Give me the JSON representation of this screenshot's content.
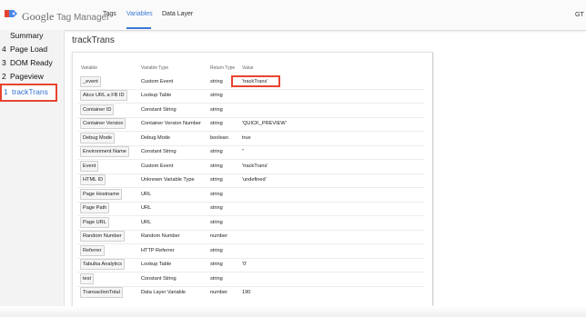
{
  "header": {
    "brand_google": "Google",
    "brand_product": "Tag Manager",
    "nav": [
      "Tags",
      "Variables",
      "Data Layer"
    ],
    "active_nav": "Variables",
    "right_label": "GT",
    "accent_color": "#3a78d4"
  },
  "sidebar": {
    "items": [
      {
        "num": "",
        "label": "Summary"
      },
      {
        "num": "4",
        "label": "Page Load"
      },
      {
        "num": "3",
        "label": "DOM Ready"
      },
      {
        "num": "2",
        "label": "Pageview"
      },
      {
        "num": "1",
        "label": "trackTrans"
      }
    ],
    "selected": "trackTrans",
    "highlight_color": "#e8432f"
  },
  "main": {
    "title": "trackTrans",
    "columns": [
      "Variable",
      "Variable Type",
      "Return Type",
      "Value"
    ],
    "rows": [
      {
        "variable": "_event",
        "type": "Custom Event",
        "return": "string",
        "value": "'trackTrans'"
      },
      {
        "variable": "Akce URL a FB ID",
        "type": "Lookup Table",
        "return": "string",
        "value": ""
      },
      {
        "variable": "Container ID",
        "type": "Constant String",
        "return": "string",
        "value": ""
      },
      {
        "variable": "Container Version",
        "type": "Container Version Number",
        "return": "string",
        "value": "'QUICK_PREVIEW'"
      },
      {
        "variable": "Debug Mode",
        "type": "Debug Mode",
        "return": "boolean",
        "value": "true"
      },
      {
        "variable": "Environment Name",
        "type": "Constant String",
        "return": "string",
        "value": "''"
      },
      {
        "variable": "Event",
        "type": "Custom Event",
        "return": "string",
        "value": "'trackTrans'"
      },
      {
        "variable": "HTML ID",
        "type": "Unknown Variable Type",
        "return": "string",
        "value": "'undefined'"
      },
      {
        "variable": "Page Hostname",
        "type": "URL",
        "return": "string",
        "value": ""
      },
      {
        "variable": "Page Path",
        "type": "URL",
        "return": "string",
        "value": ""
      },
      {
        "variable": "Page URL",
        "type": "URL",
        "return": "string",
        "value": ""
      },
      {
        "variable": "Random Number",
        "type": "Random Number",
        "return": "number",
        "value": ""
      },
      {
        "variable": "Referrer",
        "type": "HTTP Referrer",
        "return": "string",
        "value": ""
      },
      {
        "variable": "Tabulka Analytics",
        "type": "Lookup Table",
        "return": "string",
        "value": "'0'"
      },
      {
        "variable": "test",
        "type": "Constant String",
        "return": "string",
        "value": ""
      },
      {
        "variable": "TransactionTotal",
        "type": "Data Layer Variable",
        "return": "number",
        "value": "190"
      }
    ]
  }
}
